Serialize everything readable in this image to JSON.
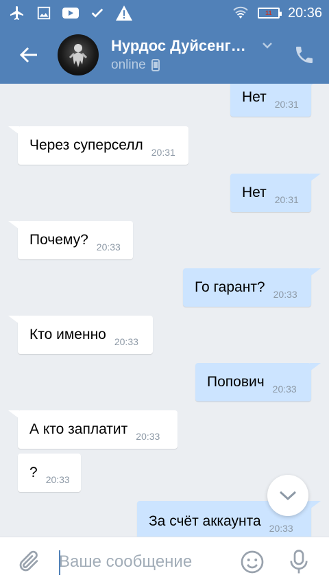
{
  "status_bar": {
    "time": "20:36",
    "battery_level": "11",
    "icons": [
      "airplane-icon",
      "image-icon",
      "youtube-icon",
      "check-icon",
      "warning-icon",
      "wifi-icon",
      "battery-icon"
    ]
  },
  "header": {
    "name": "Нурдос Дуйсенг…",
    "status": "online",
    "icons": [
      "back-arrow-icon",
      "chevron-down-icon",
      "phone-icon",
      "mobile-device-icon"
    ]
  },
  "messages": [
    {
      "direction": "out",
      "text": "Нет",
      "time": "20:31"
    },
    {
      "direction": "in",
      "text": "Через суперселл",
      "time": "20:31"
    },
    {
      "direction": "out",
      "text": "Нет",
      "time": "20:31"
    },
    {
      "direction": "in",
      "text": "Почему?",
      "time": "20:33"
    },
    {
      "direction": "out",
      "text": "Го гарант?",
      "time": "20:33"
    },
    {
      "direction": "in",
      "text": "Кто именно",
      "time": "20:33"
    },
    {
      "direction": "out",
      "text": "Попович",
      "time": "20:33"
    },
    {
      "direction": "in",
      "text": "А кто заплатит",
      "time": "20:33"
    },
    {
      "direction": "in",
      "text": "?",
      "time": "20:33"
    },
    {
      "direction": "out",
      "text": "За счёт аккаунта",
      "time": "20:33"
    }
  ],
  "composer": {
    "placeholder": "Ваше сообщение",
    "value": "",
    "icons": [
      "paperclip-icon",
      "emoji-icon",
      "microphone-icon"
    ]
  },
  "colors": {
    "brand": "#5181b8",
    "incoming_bubble": "#ffffff",
    "outgoing_bubble": "#cce4ff",
    "background": "#ebeef2"
  }
}
